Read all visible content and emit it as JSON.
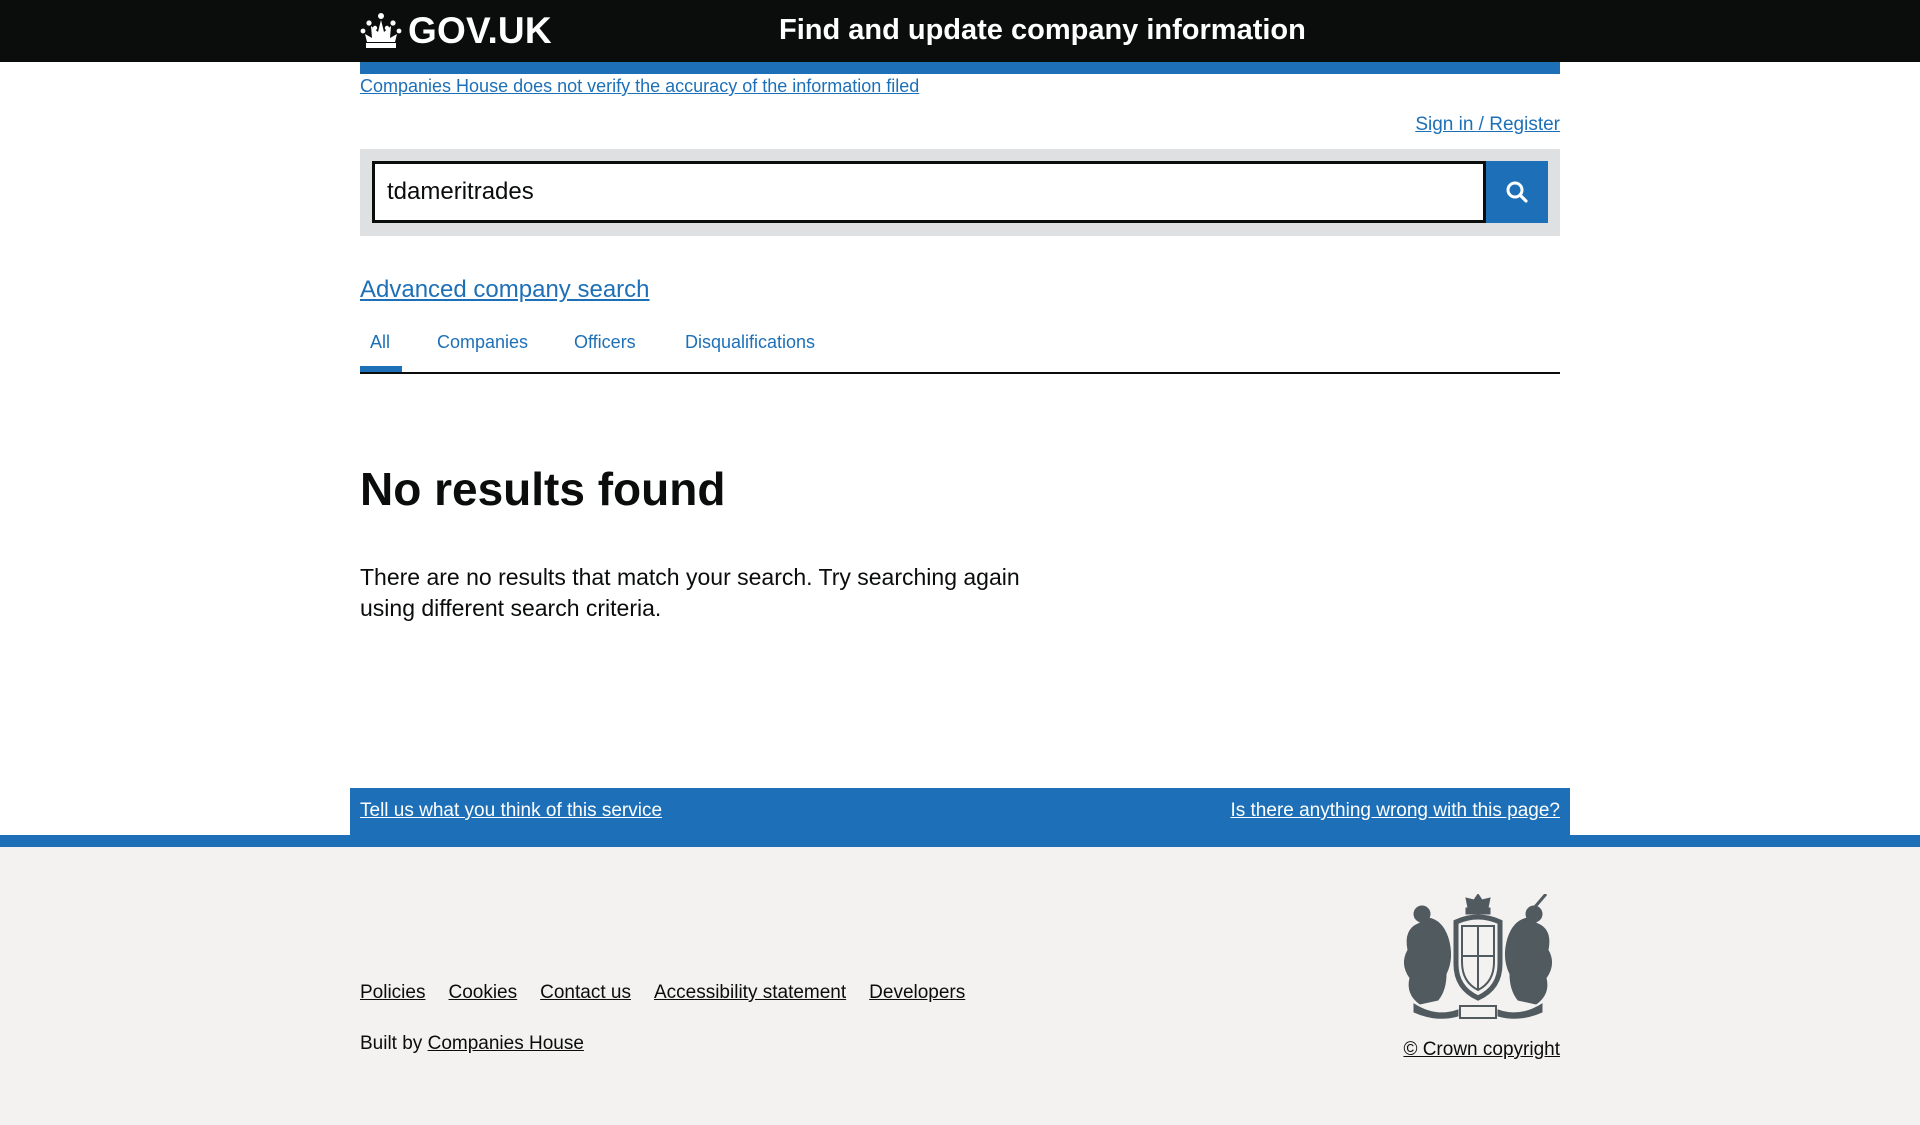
{
  "header": {
    "logo_text": "GOV.UK",
    "service_name": "Find and update company information"
  },
  "disclaimer": "Companies House does not verify the accuracy of the information filed",
  "signin": "Sign in / Register",
  "search": {
    "value": "tdameritrades",
    "button_icon": "search-icon"
  },
  "advanced_search": "Advanced company search",
  "tabs": [
    {
      "label": "All",
      "selected": true
    },
    {
      "label": "Companies",
      "selected": false
    },
    {
      "label": "Officers",
      "selected": false
    },
    {
      "label": "Disqualifications",
      "selected": false
    }
  ],
  "main": {
    "heading": "No results found",
    "body": "There are no results that match your search. Try searching again using different search criteria."
  },
  "feedback": {
    "left": "Tell us what you think of this service",
    "right": "Is there anything wrong with this page?"
  },
  "footer": {
    "links": [
      "Policies",
      "Cookies",
      "Contact us",
      "Accessibility statement",
      "Developers"
    ],
    "built_by_prefix": "Built by",
    "built_by_link": "Companies House",
    "copyright": "© Crown copyright"
  },
  "colors": {
    "header_bg": "#0b0c0c",
    "brand_blue": "#1d70b8",
    "footer_bg": "#f3f2f1",
    "search_panel_bg": "#dee0e2"
  }
}
